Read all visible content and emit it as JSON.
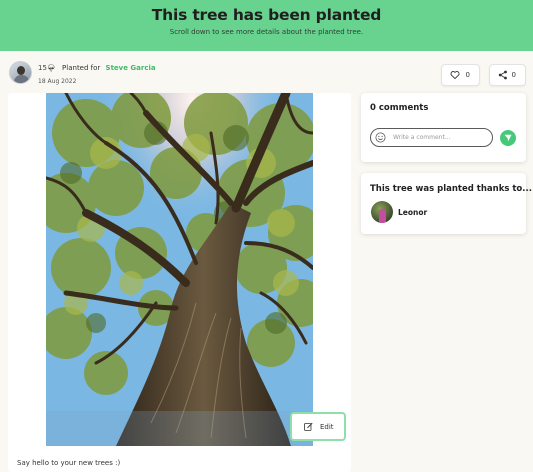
{
  "banner": {
    "title": "This tree has been planted",
    "subtitle": "Scroll down to see more details about the planted tree."
  },
  "author": {
    "tree_count": "15",
    "tree_icon": "tree-icon",
    "planted_for_label": "Planted for",
    "recipient_name": "Steve Garcia",
    "date": "18 Aug 2022"
  },
  "actions": {
    "like_icon": "heart-icon",
    "like_count": "0",
    "share_icon": "share-icon",
    "share_count": "0"
  },
  "post": {
    "edit_label": "Edit",
    "caption": "Say hello to your new trees :)"
  },
  "comments": {
    "title": "0 comments",
    "placeholder": "Write a comment..."
  },
  "thanks": {
    "title": "This tree was planted thanks to...",
    "planter_name": "Leonor"
  },
  "colors": {
    "brand_green": "#67d38f",
    "accent_green": "#3fb96a"
  }
}
